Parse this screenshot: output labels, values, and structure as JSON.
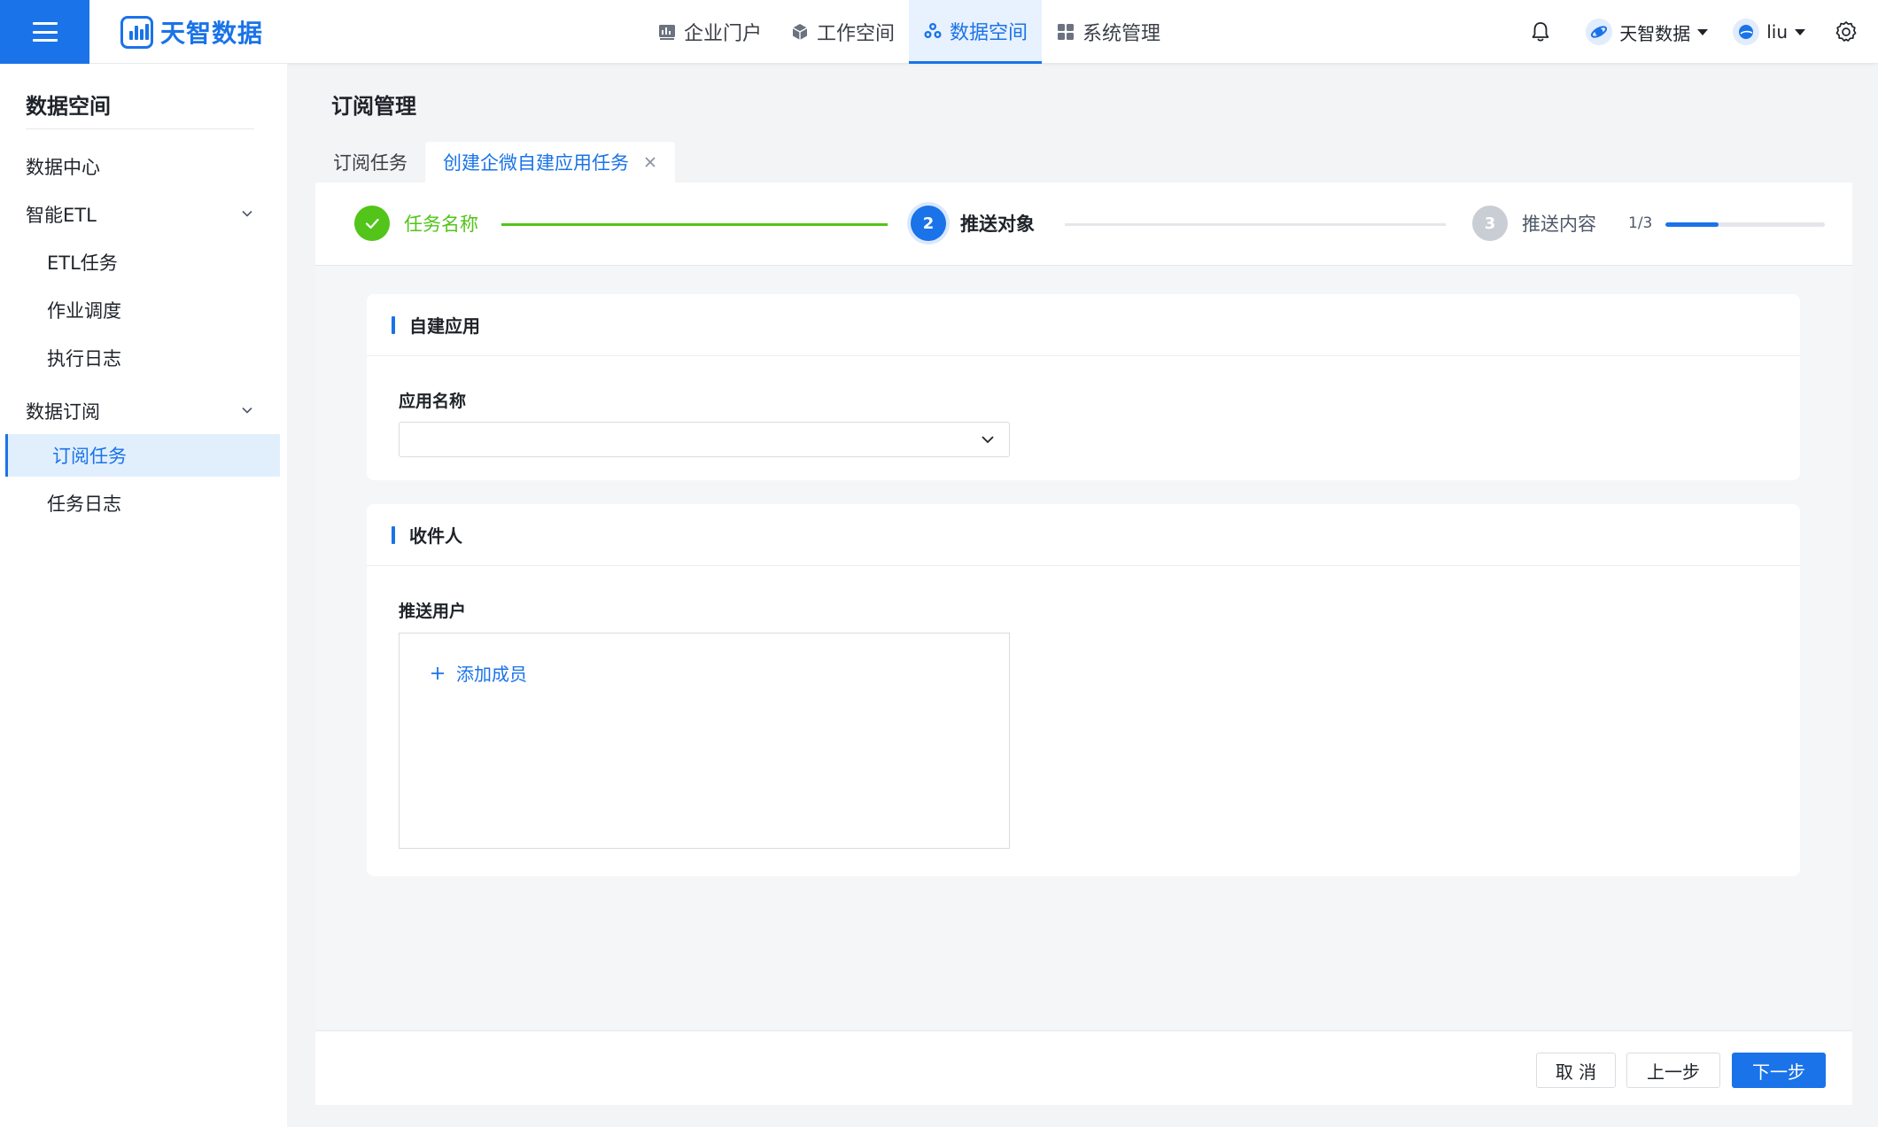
{
  "header": {
    "brand": "天智数据",
    "nav": [
      {
        "label": "企业门户",
        "icon": "chart-board-icon",
        "active": false
      },
      {
        "label": "工作空间",
        "icon": "cube-icon",
        "active": false
      },
      {
        "label": "数据空间",
        "icon": "cluster-icon",
        "active": true
      },
      {
        "label": "系统管理",
        "icon": "grid-icon",
        "active": false
      }
    ],
    "org_name": "天智数据",
    "username": "liu"
  },
  "sidebar": {
    "title": "数据空间",
    "items": [
      {
        "label": "数据中心",
        "level": 1
      },
      {
        "label": "智能ETL",
        "level": 1,
        "expandable": true
      },
      {
        "label": "ETL任务",
        "level": 2
      },
      {
        "label": "作业调度",
        "level": 2
      },
      {
        "label": "执行日志",
        "level": 2
      },
      {
        "label": "数据订阅",
        "level": 1,
        "expandable": true
      },
      {
        "label": "订阅任务",
        "level": 2,
        "active": true
      },
      {
        "label": "任务日志",
        "level": 2
      }
    ]
  },
  "main": {
    "page_title": "订阅管理",
    "tabs": [
      {
        "label": "订阅任务",
        "active": false
      },
      {
        "label": "创建企微自建应用任务",
        "active": true,
        "closable": true
      }
    ],
    "steps": [
      {
        "number": "",
        "label": "任务名称",
        "state": "done"
      },
      {
        "number": "2",
        "label": "推送对象",
        "state": "current"
      },
      {
        "number": "3",
        "label": "推送内容",
        "state": "todo"
      }
    ],
    "progress": {
      "text": "1/3",
      "fraction": 0.333
    },
    "app_section": {
      "title": "自建应用",
      "field_label": "应用名称",
      "select_value": ""
    },
    "recipient_section": {
      "title": "收件人",
      "field_label": "推送用户",
      "add_label": "添加成员"
    }
  },
  "footer": {
    "cancel": "取 消",
    "prev": "上一步",
    "next": "下一步"
  },
  "colors": {
    "accent": "#1a73e8",
    "success": "#52c41a",
    "muted": "#c9cdd4"
  }
}
